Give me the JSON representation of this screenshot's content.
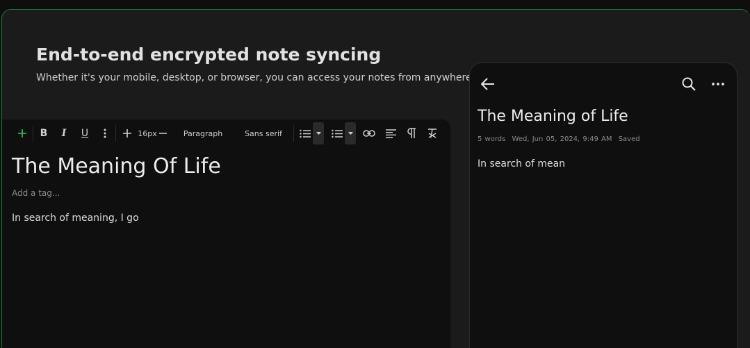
{
  "hero": {
    "title": "End-to-end encrypted note syncing",
    "subtitle": "Whether it's your mobile, desktop, or browser, you can access your notes from anywhere, a"
  },
  "editor": {
    "toolbar": {
      "add_icon": "plus-icon",
      "bold_label": "B",
      "italic_label": "I",
      "underline_label": "U",
      "more_icon": "vertical-dots-icon",
      "font_size": "16px",
      "block_type": "Paragraph",
      "font_family": "Sans serif",
      "ordered_list_icon": "ordered-list-icon",
      "bullet_list_icon": "bullet-list-icon",
      "link_icon": "link-icon",
      "align_icon": "align-left-icon",
      "direction_icon": "pilcrow-icon",
      "clear_format_icon": "clear-format-icon"
    },
    "title": "The Meaning Of Life",
    "tag_placeholder": "Add a tag...",
    "body": "In search of meaning, I go",
    "accent_color": "#2fb35a"
  },
  "mobile": {
    "back_icon": "arrow-left-icon",
    "search_icon": "search-icon",
    "menu_icon": "horizontal-dots-icon",
    "title": "The Meaning of Life",
    "meta": {
      "words": "5 words",
      "date": "Wed, Jun 05, 2024, 9:49 AM",
      "status": "Saved"
    },
    "body": "In search of mean"
  }
}
